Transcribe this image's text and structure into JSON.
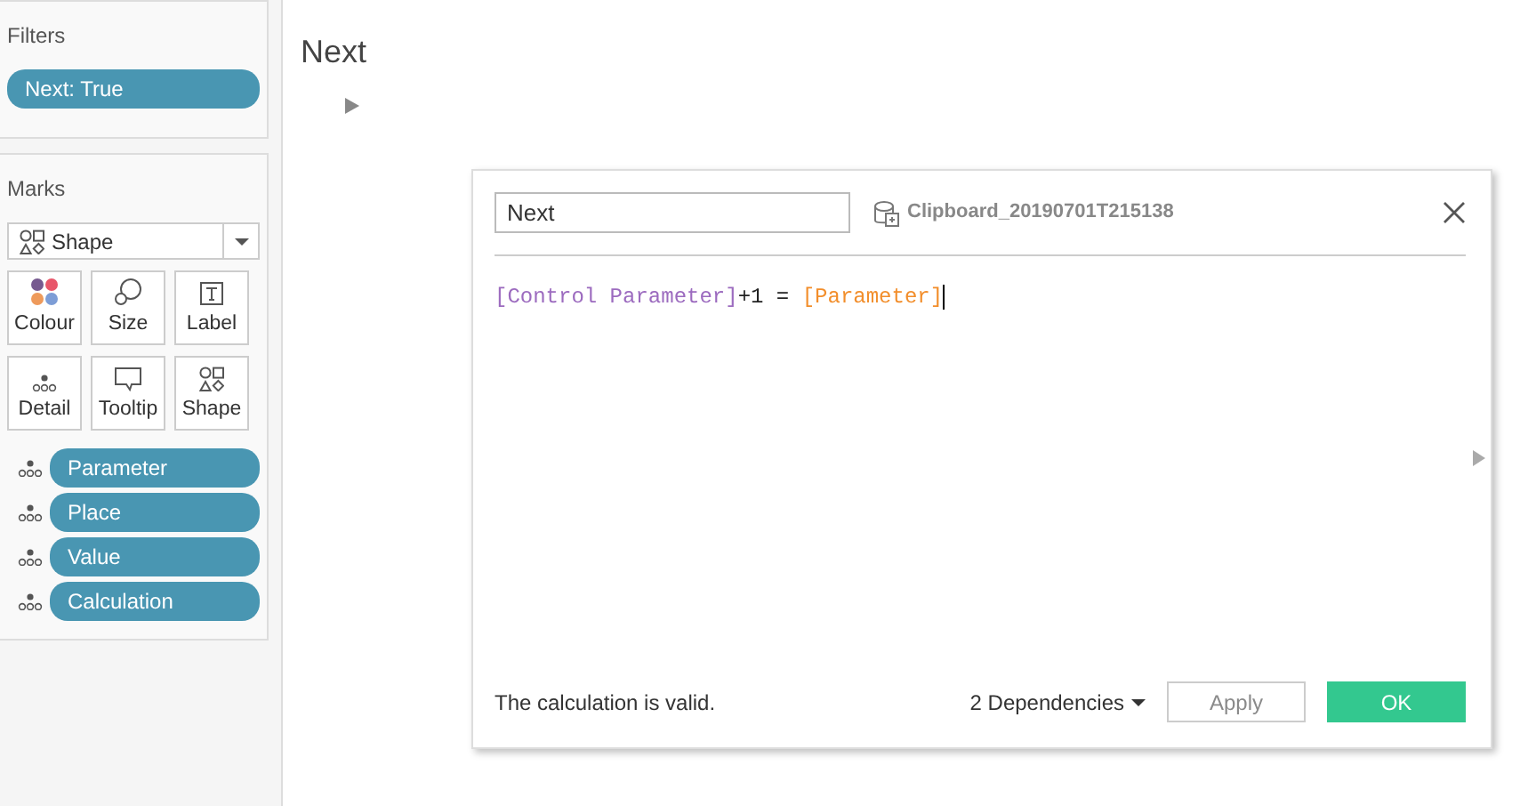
{
  "filters": {
    "title": "Filters",
    "pills": [
      "Next: True"
    ]
  },
  "marks": {
    "title": "Marks",
    "mark_type": "Shape",
    "cards": [
      {
        "kind": "colour",
        "label": "Colour"
      },
      {
        "kind": "size",
        "label": "Size"
      },
      {
        "kind": "label",
        "label": "Label"
      },
      {
        "kind": "detail",
        "label": "Detail"
      },
      {
        "kind": "tooltip",
        "label": "Tooltip"
      },
      {
        "kind": "shape",
        "label": "Shape"
      }
    ],
    "fields": [
      "Parameter",
      "Place",
      "Value",
      "Calculation"
    ]
  },
  "sheet": {
    "title": "Next"
  },
  "dialog": {
    "name": "Next",
    "datasource": "Clipboard_20190701T215138",
    "formula": [
      {
        "kind": "field",
        "text": "[Control Parameter]"
      },
      {
        "kind": "operator",
        "text": "+1 = "
      },
      {
        "kind": "parameter",
        "text": "[Parameter]"
      }
    ],
    "status": "The calculation is valid.",
    "dependencies": "2 Dependencies",
    "buttons": [
      {
        "label": "Apply",
        "disabled": true
      },
      {
        "label": "OK",
        "disabled": false
      }
    ]
  }
}
